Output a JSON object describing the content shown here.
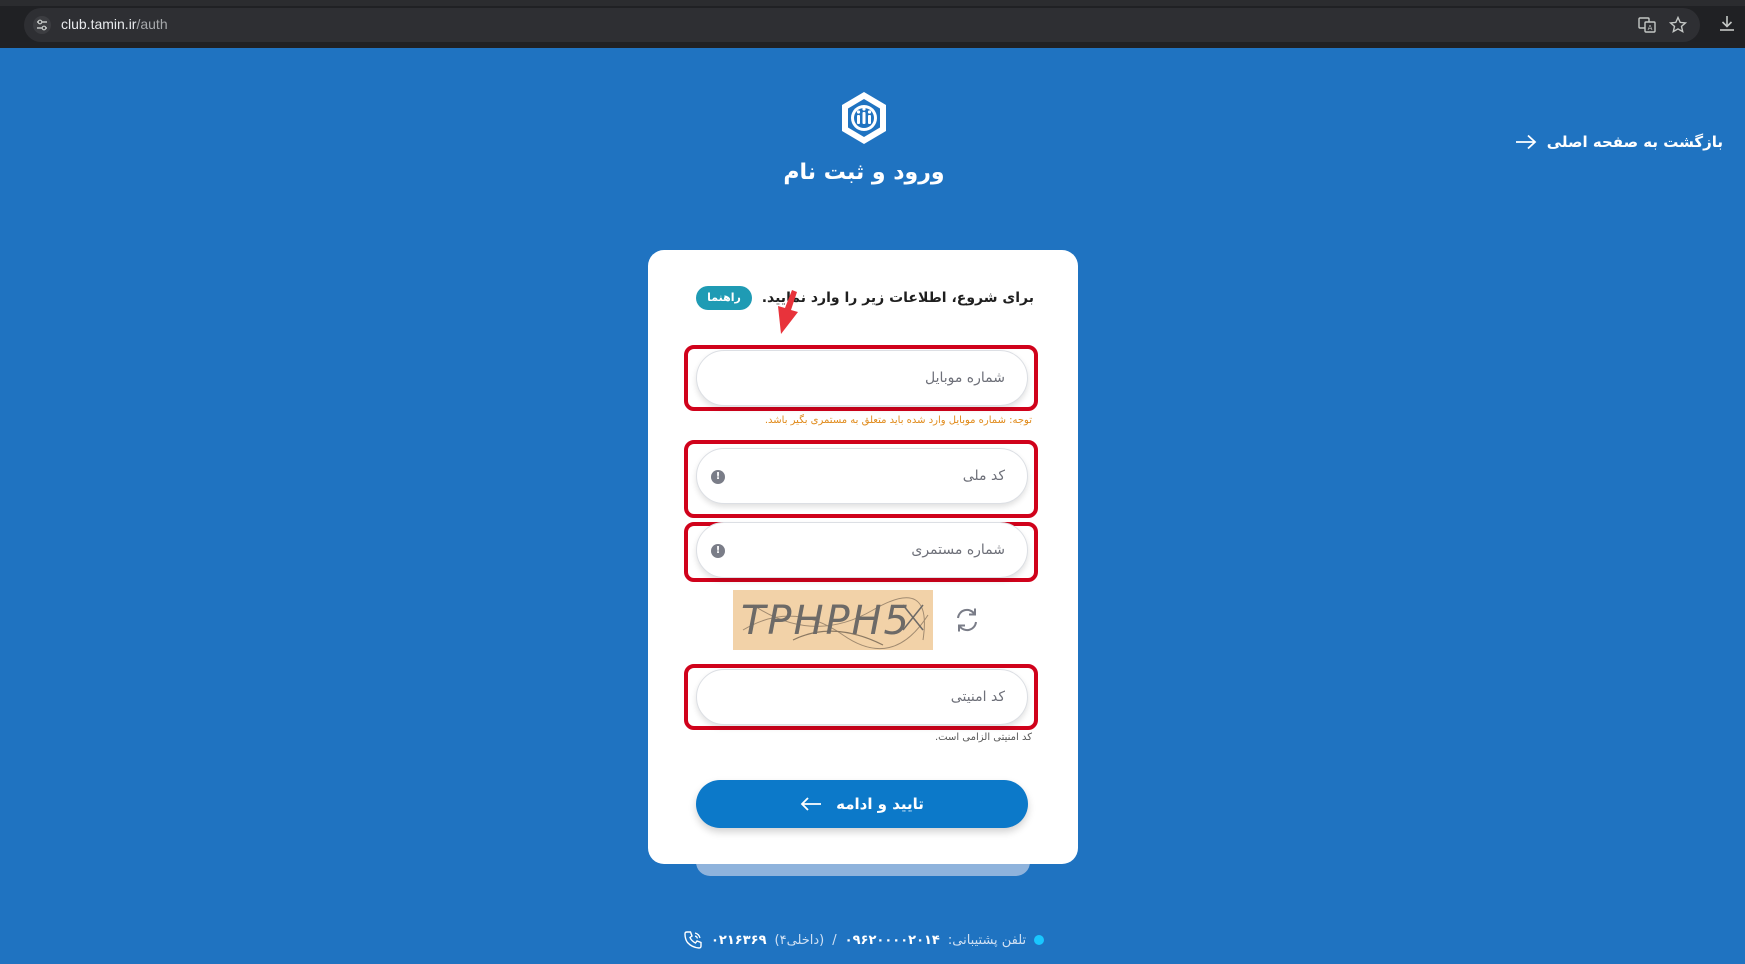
{
  "browser": {
    "url_host": "club.tamin.ir",
    "url_path": "/auth",
    "icons": [
      "tune-icon",
      "translate-icon",
      "star-icon",
      "download-icon"
    ]
  },
  "page": {
    "title": "ورود و ثبت نام",
    "back_link": "بازگشت به صفحه اصلی"
  },
  "form": {
    "intro": "برای شروع، اطلاعات زیر را وارد نمایید.",
    "guide_label": "راهنما",
    "mobile_placeholder": "شماره موبایل",
    "mobile_note": "توجه: شماره موبایل وارد شده باید متعلق به مستمری بگیر باشد.",
    "national_code_placeholder": "کد ملی",
    "pension_number_placeholder": "شماره مستمری",
    "captcha_text": "TPHPH5",
    "security_code_placeholder": "کد امنیتی",
    "security_code_note": "کد امنیتی الزامی است.",
    "submit_label": "تایید و ادامه"
  },
  "footer": {
    "support_label": "تلفن پشتیبانی:",
    "support_number": "۰۹۶۲۰۰۰۰۲۰۱۴",
    "separator": "/",
    "extension": "(داخلی۴)",
    "second_number": "۰۲۱۶۳۶۹"
  },
  "colors": {
    "background": "#1f73c1",
    "highlight": "#d0021b",
    "button": "#0c79c9",
    "badge": "#1f9bb4",
    "warning_text": "#e08a1a"
  }
}
